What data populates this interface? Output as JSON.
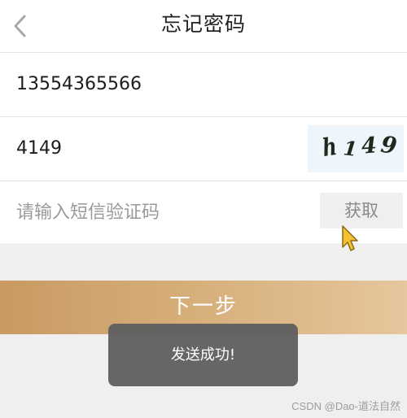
{
  "header": {
    "title": "忘记密码",
    "back_icon": "chevron-left-icon"
  },
  "form": {
    "phone_value": "13554365566",
    "image_code_value": "4149",
    "captcha_chars": [
      "h",
      "1",
      "4",
      "9"
    ],
    "sms_code_placeholder": "请输入短信验证码",
    "get_code_label": "获取"
  },
  "next_button_label": "下一步",
  "toast_message": "发送成功!",
  "watermark": "CSDN @Dao-道法自然",
  "colors": {
    "accent_start": "#c99a62",
    "accent_end": "#e6c69d",
    "toast_bg": "#606060",
    "page_bg": "#efeff0"
  }
}
